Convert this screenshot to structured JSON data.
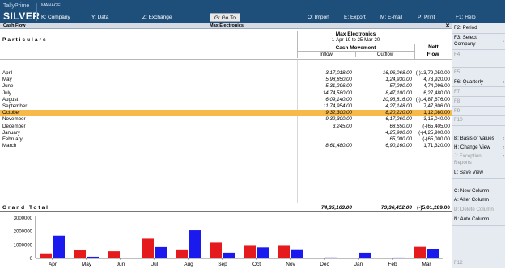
{
  "app": {
    "brand_top": "TallyPrime",
    "brand_bottom": "SILVER",
    "manage": "MANAGE"
  },
  "top_menu": [
    {
      "key": "K",
      "label": "K: Company"
    },
    {
      "key": "Y",
      "label": "Y: Data"
    },
    {
      "key": "Z",
      "label": "Z: Exchange"
    },
    {
      "key": "G",
      "label": "G: Go To"
    },
    {
      "key": "O",
      "label": "O: Import"
    },
    {
      "key": "E",
      "label": "E: Export"
    },
    {
      "key": "M",
      "label": "M: E-mail"
    },
    {
      "key": "P",
      "label": "P: Print"
    },
    {
      "key": "F1",
      "label": "F1: Help"
    }
  ],
  "title_strip": {
    "left": "Cash Flow",
    "center": "Max Electronics",
    "close": "✕"
  },
  "report": {
    "particulars": "Particulars",
    "company": "Max Electronics",
    "period": "1-Apr-19 to 25-Mar-20",
    "cash_movement": "Cash Movement",
    "inflow": "Inflow",
    "outflow": "Outflow",
    "nett1": "Nett",
    "nett2": "Flow"
  },
  "rows": [
    {
      "month": "April",
      "inflow": "3,17,018.00",
      "outflow": "16,96,068.00",
      "nett": "(-)13,79,050.00"
    },
    {
      "month": "May",
      "inflow": "5,98,850.00",
      "outflow": "1,24,930.00",
      "nett": "4,73,920.00"
    },
    {
      "month": "June",
      "inflow": "5,31,296.00",
      "outflow": "57,200.00",
      "nett": "4,74,096.00"
    },
    {
      "month": "July",
      "inflow": "14,74,580.00",
      "outflow": "8,47,100.00",
      "nett": "6,27,480.00"
    },
    {
      "month": "August",
      "inflow": "6,09,140.00",
      "outflow": "20,96,816.00",
      "nett": "(-)14,87,676.00"
    },
    {
      "month": "September",
      "inflow": "11,74,954.00",
      "outflow": "4,27,148.00",
      "nett": "7,47,806.00"
    },
    {
      "month": "October",
      "inflow": "9,32,300.00",
      "outflow": "8,20,220.00",
      "nett": "1,12,080.00",
      "highlight": true
    },
    {
      "month": "November",
      "inflow": "9,32,300.00",
      "outflow": "6,17,260.00",
      "nett": "3,15,040.00"
    },
    {
      "month": "December",
      "inflow": "3,245.00",
      "outflow": "68,650.00",
      "nett": "(-)65,405.00"
    },
    {
      "month": "January",
      "inflow": "",
      "outflow": "4,25,900.00",
      "nett": "(-)4,25,900.00"
    },
    {
      "month": "February",
      "inflow": "",
      "outflow": "65,000.00",
      "nett": "(-)65,000.00"
    },
    {
      "month": "March",
      "inflow": "8,61,480.00",
      "outflow": "6,90,160.00",
      "nett": "1,71,320.00"
    }
  ],
  "grand_total": {
    "label": "Grand Total",
    "inflow": "74,35,163.00",
    "outflow": "79,36,452.00",
    "nett": "(-)5,01,289.00"
  },
  "chart_data": {
    "type": "bar",
    "categories": [
      "Apr",
      "May",
      "Jun",
      "Jul",
      "Aug",
      "Sep",
      "Oct",
      "Nov",
      "Dec",
      "Jan",
      "Feb",
      "Mar"
    ],
    "series": [
      {
        "color": "#e41a1c",
        "values": [
          317018,
          598850,
          531296,
          1474580,
          609140,
          1174954,
          932300,
          932300,
          3245,
          0,
          0,
          861480
        ]
      },
      {
        "color": "#1a1aee",
        "values": [
          1696068,
          124930,
          57200,
          847100,
          2096816,
          427148,
          820220,
          617260,
          68650,
          425900,
          65000,
          690160
        ]
      }
    ],
    "yticks": [
      "3000000",
      "2000000",
      "1000000",
      "0"
    ],
    "ylim": [
      0,
      3000000
    ],
    "grid": false
  },
  "right_panel": [
    {
      "label": "F2: Period",
      "enabled": true
    },
    {
      "label": "F3: Select Company",
      "enabled": true
    },
    {
      "label": "F4",
      "enabled": false
    },
    {
      "label": "F5",
      "enabled": false
    },
    {
      "label": "F6: Quarterly",
      "enabled": true
    },
    {
      "label": "F7",
      "enabled": false
    },
    {
      "label": "F8",
      "enabled": false
    },
    {
      "label": "F9",
      "enabled": false
    },
    {
      "label": "F10",
      "enabled": false
    },
    {
      "label": "B: Basis of Values",
      "enabled": true
    },
    {
      "label": "H: Change View",
      "enabled": true
    },
    {
      "label": "J: Exception Reports",
      "enabled": false
    },
    {
      "label": "L: Save View",
      "enabled": true
    },
    {
      "label": "C: New Column",
      "enabled": true
    },
    {
      "label": "A: Alter Column",
      "enabled": true
    },
    {
      "label": "D: Delete Column",
      "enabled": false
    },
    {
      "label": "N: Auto Column",
      "enabled": true
    },
    {
      "label": "F12",
      "enabled": false
    }
  ]
}
